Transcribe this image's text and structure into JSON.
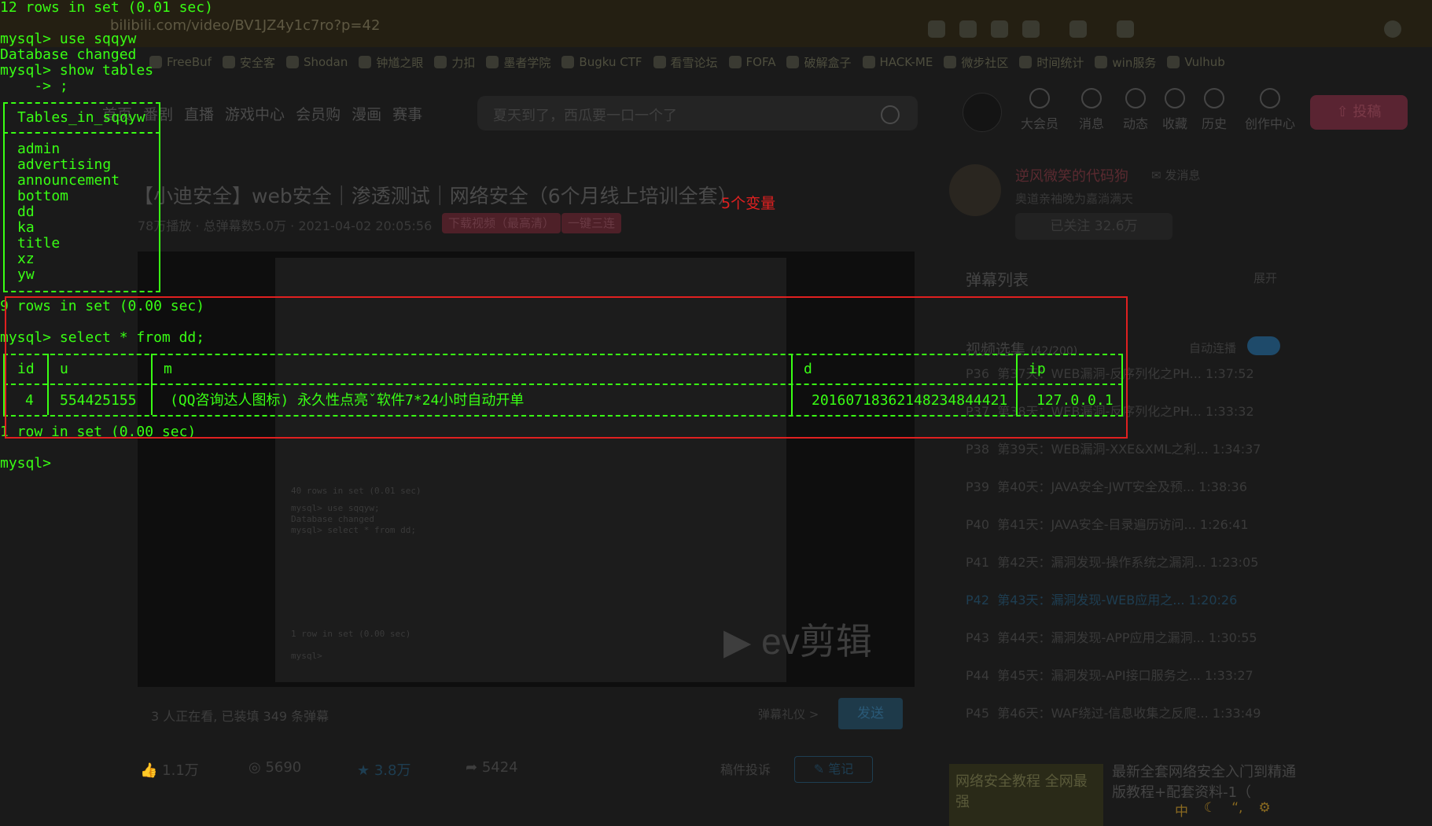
{
  "browser": {
    "url": "bilibili.com/video/BV1JZ4y1c7ro?p=42",
    "bookmarks": [
      "FreeBuf",
      "安全客",
      "Shodan",
      "钟馗之眼",
      "力扣",
      "墨者学院",
      "Bugku CTF",
      "看雪论坛",
      "FOFA",
      "破解盒子",
      "HACK-ME",
      "微步社区",
      "时间统计",
      "win服务",
      "Vulhub"
    ]
  },
  "site": {
    "nav": [
      "首页",
      "番剧",
      "直播",
      "游戏中心",
      "会员购",
      "漫画",
      "赛事"
    ],
    "search_placeholder": "夏天到了，西瓜要一口一个了",
    "header_items": [
      "大会员",
      "消息",
      "动态",
      "收藏",
      "历史",
      "创作中心"
    ],
    "post_label": "投稿"
  },
  "video": {
    "title": "【小迪安全】web安全｜渗透测试｜网络安全（6个月线上培训全套）",
    "meta": "78万播放 · 总弹幕数5.0万 · 2021-04-02 20:05:56",
    "pill_download": "下载视频（最高清）",
    "pill_triple": "一键三连",
    "annotation": "5个变量",
    "viewer_info": "3 人正在看, 已装填 349 条弹幕",
    "danmu_etiquette": "弹幕礼仪 >",
    "send_label": "发送",
    "actions": {
      "like": "1.1万",
      "coin": "5690",
      "fav": "3.8万",
      "share": "5424"
    },
    "report": "稿件投诉",
    "note": "笔记"
  },
  "sidebar": {
    "up_name": "逆风微笑的代码狗",
    "send_msg": "发消息",
    "up_desc": "奥道亲袖晚为嘉淌满天",
    "follow": "已关注 32.6万",
    "danmu_list": "弹幕列表",
    "expand": "展开",
    "episodes_title": "视频选集",
    "episodes_count": "(42/200)",
    "autoplay": "自动连播",
    "episodes": [
      {
        "p": "P36",
        "title": "第37天：WEB漏洞-反序列化之PH...",
        "dur": "1:37:52"
      },
      {
        "p": "P37",
        "title": "第38天：WEB漏洞-反序列化之PH...",
        "dur": "1:33:32"
      },
      {
        "p": "P38",
        "title": "第39天：WEB漏洞-XXE&XML之利...",
        "dur": "1:34:37"
      },
      {
        "p": "P39",
        "title": "第40天：JAVA安全-JWT安全及预...",
        "dur": "1:38:36"
      },
      {
        "p": "P40",
        "title": "第41天：JAVA安全-目录遍历访问...",
        "dur": "1:26:41"
      },
      {
        "p": "P41",
        "title": "第42天：漏洞发现-操作系统之漏洞...",
        "dur": "1:23:05"
      },
      {
        "p": "P42",
        "title": "第43天：漏洞发现-WEB应用之...",
        "dur": "1:20:26"
      },
      {
        "p": "P43",
        "title": "第44天：漏洞发现-APP应用之漏洞...",
        "dur": "1:30:55"
      },
      {
        "p": "P44",
        "title": "第45天：漏洞发现-API接口服务之...",
        "dur": "1:33:27"
      },
      {
        "p": "P45",
        "title": "第46天：WAF绕过-信息收集之反爬...",
        "dur": "1:33:49"
      }
    ],
    "ad_text": "最新全套网络安全入门到精通版教程+配套资料-1（",
    "ad_img_text": "网络安全教程 全网最强",
    "ime": [
      "中",
      "☾",
      "“,",
      "⚙"
    ]
  },
  "terminal": {
    "lines_top": [
      "12 rows in set (0.01 sec)",
      "mysql> use sqqyw",
      "Database changed",
      "mysql> show tables",
      "    -> ;"
    ],
    "tables_header": "Tables_in_sqqyw",
    "tables": [
      "admin",
      "advertising",
      "announcement",
      "bottom",
      "dd",
      "ka",
      "title",
      "xz",
      "yw"
    ],
    "rows_in_set_1": "9 rows in set (0.00 sec)",
    "query": "mysql> select * from dd;",
    "cols": [
      "id",
      "u",
      "m",
      "d",
      "ip"
    ],
    "row": [
      "4",
      "554425155",
      "(QQ咨询达人图标) 永久性点亮ˇ软件7*24小时自动开单",
      "20160718362148234844421",
      "127.0.0.1"
    ],
    "rows_in_set_2": "1 row in set (0.00 sec)",
    "prompt": "mysql>"
  }
}
